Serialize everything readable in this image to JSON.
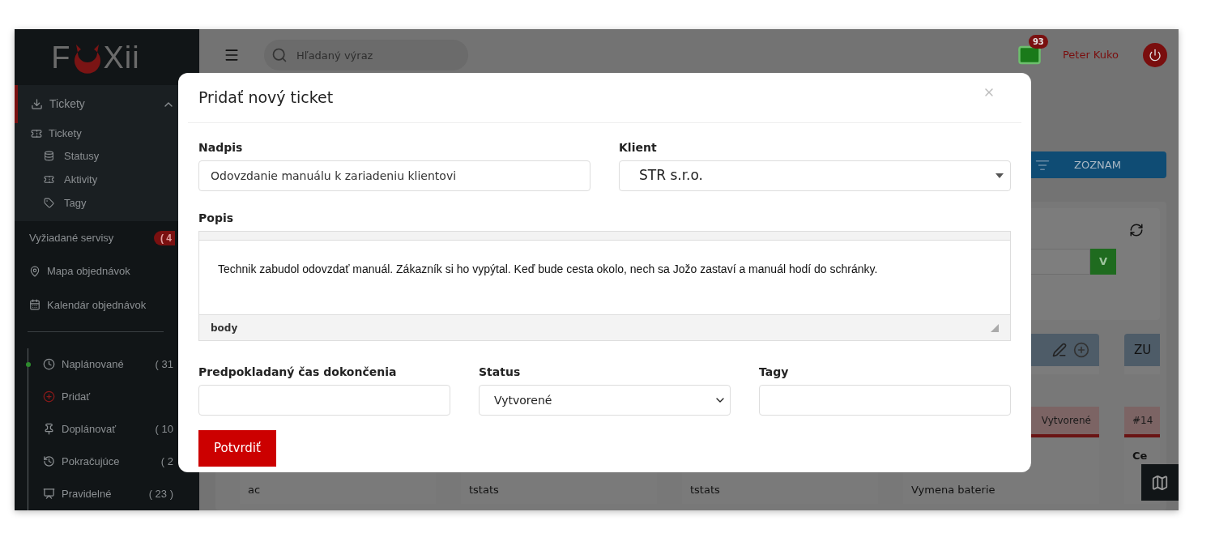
{
  "sidebar": {
    "logo": {
      "left": "F",
      "right": "Xii"
    },
    "section": {
      "label": "Tickety",
      "expanded": true,
      "items": [
        {
          "label": "Tickety",
          "children": [
            {
              "label": "Statusy"
            },
            {
              "label": "Aktivity"
            },
            {
              "label": "Tagy"
            }
          ]
        }
      ]
    },
    "links": [
      {
        "label": "Vyžiadané servisy",
        "count": "( 4"
      },
      {
        "label": "Mapa objednávok"
      },
      {
        "label": "Kalendár objednávok"
      }
    ],
    "timeline": [
      {
        "label": "Naplánované",
        "count": "( 31",
        "active": true
      },
      {
        "label": "Pridať",
        "active": false
      },
      {
        "label": "Doplánovať",
        "count": "( 10",
        "active": false
      },
      {
        "label": "Pokračujúce",
        "count": "( 2",
        "active": false
      },
      {
        "label": "Pravidelné",
        "count": "( 23 )",
        "active": false
      }
    ]
  },
  "topbar": {
    "search": {
      "placeholder": "Hľadaný výraz"
    },
    "mail_badge": "93",
    "user": "Peter Kuko"
  },
  "content": {
    "view_button": "ZOZNAM",
    "filter_button": "V",
    "columns": [
      {},
      {},
      {},
      {
        "actions": true
      },
      {
        "header": "ZU"
      }
    ],
    "cards": [
      {
        "title": "ac"
      },
      {
        "title": "tstats"
      },
      {
        "title": "tstats"
      },
      {
        "title": "Vymena baterie",
        "status": "Vytvorené"
      },
      {
        "number": "#14",
        "title": "Ce"
      }
    ]
  },
  "modal": {
    "title": "Pridať nový ticket",
    "fields": {
      "nadpis": {
        "label": "Nadpis",
        "value": "Odovzdanie manuálu k zariadeniu klientovi"
      },
      "klient": {
        "label": "Klient",
        "value": "STR s.r.o."
      },
      "popis": {
        "label": "Popis",
        "value": "Technik zabudol odovzdať manuál. Zákazník si ho vypýtal. Keď bude cesta okolo, nech sa Jožo zastaví a manuál hodí do schránky.",
        "path": "body"
      },
      "cas": {
        "label": "Predpokladaný čas dokončenia"
      },
      "status": {
        "label": "Status",
        "value": "Vytvorené"
      },
      "tagy": {
        "label": "Tagy"
      }
    },
    "submit": "Potvrdiť"
  }
}
